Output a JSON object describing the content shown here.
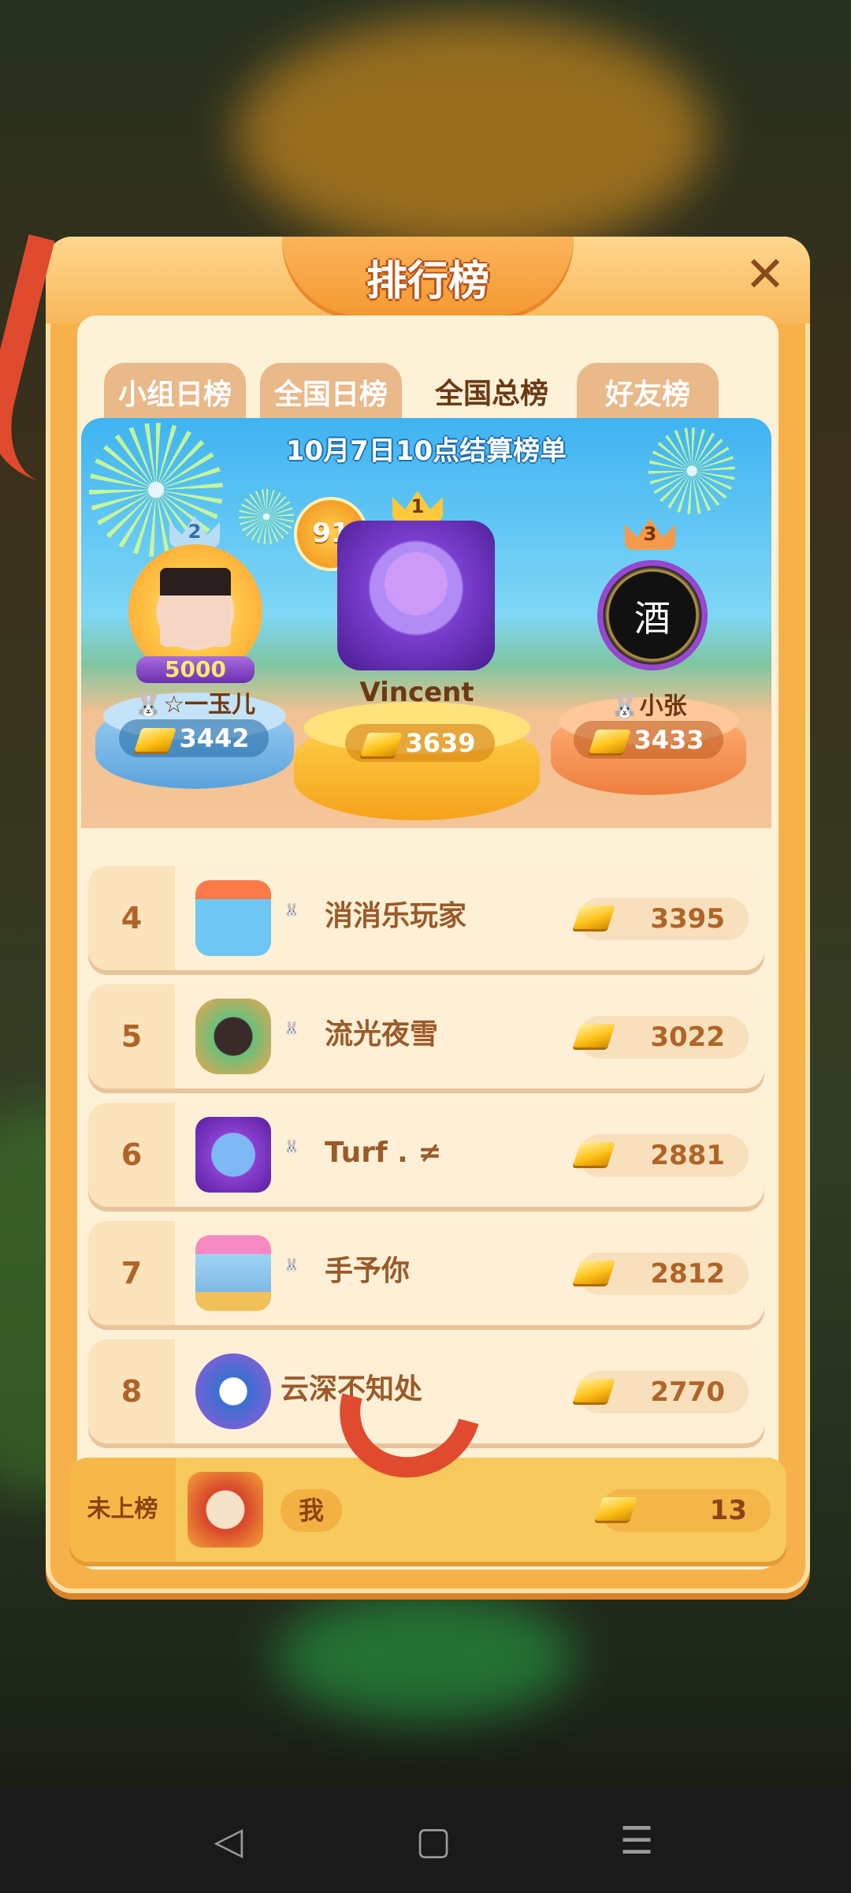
{
  "title": "排行榜",
  "close_label": "✕",
  "tabs": [
    {
      "label": "小组日榜",
      "active": false
    },
    {
      "label": "全国日榜",
      "active": false
    },
    {
      "label": "全国总榜",
      "active": true
    },
    {
      "label": "好友榜",
      "active": false
    }
  ],
  "settlement_text": "10月7日10点结算榜单",
  "podium": {
    "first": {
      "rank": "1",
      "name": "Vincent",
      "score": "3639",
      "level": "91"
    },
    "second": {
      "rank": "2",
      "name": "☆一玉儿",
      "score": "3442",
      "frame_text": "5000"
    },
    "third": {
      "rank": "3",
      "name": "小张",
      "score": "3433",
      "avatar_text": "酒"
    }
  },
  "rows": [
    {
      "rank": "4",
      "name": "消消乐玩家",
      "score": "3395",
      "friend_icon": true
    },
    {
      "rank": "5",
      "name": "流光夜雪",
      "score": "3022",
      "friend_icon": true
    },
    {
      "rank": "6",
      "name": "Turf . ≠",
      "score": "2881",
      "friend_icon": true
    },
    {
      "rank": "7",
      "name": "手予你",
      "score": "2812",
      "friend_icon": true
    },
    {
      "rank": "8",
      "name": "云深不知处",
      "score": "2770",
      "friend_icon": false
    }
  ],
  "me": {
    "rank_label": "未上榜",
    "name": "我",
    "score": "13"
  },
  "colors": {
    "panel": "#f7b14a",
    "inner": "#fdf1d8",
    "accent_brown": "#9a5a2a",
    "gold": "#ffc31a",
    "silver_pedestal": "#8fc7ef",
    "gold_pedestal": "#ffc23a",
    "bronze_pedestal": "#f39a5a"
  },
  "icons": {
    "close": "close-icon",
    "currency": "gold-bar-icon",
    "friend": "rabbit-friend-icon",
    "crown": "crown-icon"
  },
  "nav": {
    "back": "◁",
    "home": "▢",
    "menu": "☰"
  }
}
